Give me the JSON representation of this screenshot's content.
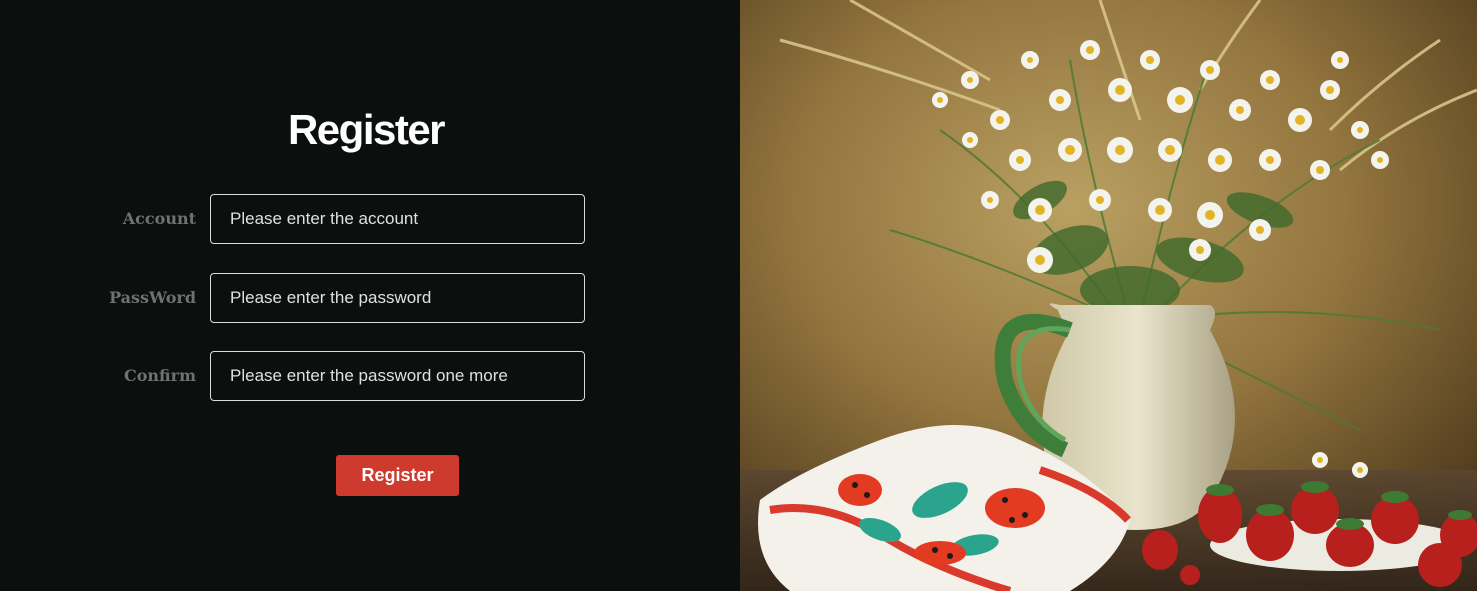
{
  "form": {
    "title": "Register",
    "fields": [
      {
        "label": "Account",
        "placeholder": "Please enter the account"
      },
      {
        "label": "PassWord",
        "placeholder": "Please enter the password"
      },
      {
        "label": "Confirm",
        "placeholder": "Please enter the password one more"
      }
    ],
    "submit_label": "Register"
  },
  "colors": {
    "background": "#0b0f0e",
    "accent": "#cf3a2e",
    "label": "#6f7271",
    "field_border": "#d9dcdb"
  },
  "image": {
    "subject": "still-life-daisies-jug-strawberries-embroidered-cloth"
  }
}
